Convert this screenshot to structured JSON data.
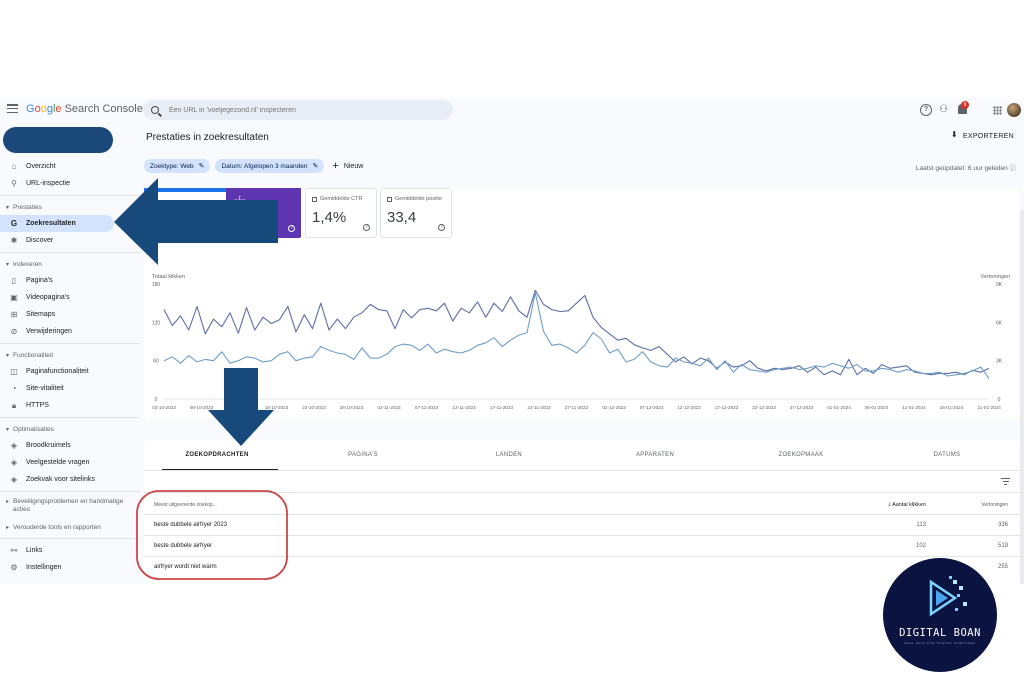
{
  "app": {
    "logo_google": [
      "G",
      "o",
      "o",
      "g",
      "l",
      "e"
    ],
    "logo_product": "Search Console",
    "search_placeholder": "Een URL in 'voeljegezond.nl' inspecteren",
    "notification_count": "9"
  },
  "sidebar": {
    "items_top": [
      {
        "label": "Overzicht",
        "icon": "home-icon"
      },
      {
        "label": "URL-inspectie",
        "icon": "search-icon"
      }
    ],
    "sections": [
      {
        "title": "Prestaties",
        "items": [
          {
            "label": "Zoekresultaten",
            "icon": "google-g-icon",
            "active": true
          },
          {
            "label": "Discover",
            "icon": "asterisk-icon"
          }
        ]
      },
      {
        "title": "Indexeren",
        "items": [
          {
            "label": "Pagina's",
            "icon": "page-icon"
          },
          {
            "label": "Videopagina's",
            "icon": "video-page-icon"
          },
          {
            "label": "Sitemaps",
            "icon": "sitemap-icon"
          },
          {
            "label": "Verwijderingen",
            "icon": "remove-icon"
          }
        ]
      },
      {
        "title": "Functionaliteit",
        "items": [
          {
            "label": "Paginafunctionaliteit",
            "icon": "page-experience-icon"
          },
          {
            "label": "Site-vitaliteit",
            "icon": "speed-icon"
          },
          {
            "label": "HTTPS",
            "icon": "lock-icon"
          }
        ]
      },
      {
        "title": "Optimalisaties",
        "items": [
          {
            "label": "Broodkruimels",
            "icon": "diamond-icon"
          },
          {
            "label": "Veelgestelde vragen",
            "icon": "diamond-icon"
          },
          {
            "label": "Zoekvak voor sitelinks",
            "icon": "diamond-icon"
          }
        ]
      }
    ],
    "collapsed": [
      "Beveiligingsproblemen en handmatige acties",
      "Verouderde tools en rapporten"
    ],
    "items_bottom": [
      {
        "label": "Links",
        "icon": "links-icon"
      },
      {
        "label": "Instellingen",
        "icon": "gear-icon"
      }
    ]
  },
  "main": {
    "title": "Prestaties in zoekresultaten",
    "export_label": "EXPORTEREN",
    "chips": [
      "Zoektype: Web",
      "Datum: Afgelopen 3 maanden"
    ],
    "new_label": "Nieuw",
    "updated": "Laatst geüpdatet: 6 uur geleden",
    "metrics": [
      {
        "label": "Gemiddelde CTR",
        "value": "1,4%"
      },
      {
        "label": "Gemiddelde positie",
        "value": "33,4"
      }
    ],
    "purple_metric_label": "...t...",
    "left_axis_title": "Totaal klikken",
    "right_axis_title": "Vertoningen"
  },
  "chart_data": {
    "type": "line",
    "x": [
      "03-10-2023",
      "08-10-2023",
      "13-10-2023",
      "18-10-2023",
      "23-10-2023",
      "28-10-2023",
      "02-11-2023",
      "07-11-2023",
      "12-11-2023",
      "17-11-2023",
      "22-11-2023",
      "27-11-2023",
      "02-12-2023",
      "07-12-2023",
      "12-12-2023",
      "17-12-2023",
      "22-12-2023",
      "27-12-2023",
      "01-01-2024",
      "06-01-2024",
      "11-01-2024",
      "16-01-2024",
      "21-01-2024"
    ],
    "y_left_ticks": [
      "0",
      "60",
      "120",
      "180"
    ],
    "y_right_ticks": [
      "0",
      "3K",
      "6K",
      "9K"
    ],
    "ylim_left": [
      0,
      180
    ],
    "ylim_right": [
      0,
      9000
    ],
    "series": [
      {
        "name": "Totaal klikken",
        "axis": "left",
        "color": "#5e6ea8",
        "values": [
          140,
          115,
          130,
          108,
          145,
          102,
          125,
          113,
          135,
          103,
          143,
          108,
          128,
          118,
          124,
          145,
          105,
          132,
          110,
          150,
          108,
          125,
          110,
          128,
          135,
          148,
          140,
          138,
          110,
          140,
          127,
          140,
          142,
          138,
          150,
          122,
          142,
          135,
          152,
          128,
          150,
          137,
          160,
          138,
          128,
          170,
          148,
          140,
          137,
          138,
          150,
          162,
          128,
          112,
          102,
          92,
          95,
          85,
          80,
          76,
          82,
          70,
          58,
          66,
          55,
          64,
          60,
          48,
          58,
          50,
          52,
          60,
          48,
          44,
          48,
          46,
          48,
          52,
          42,
          50,
          38,
          44,
          38,
          62,
          38,
          48,
          40,
          54,
          48,
          50,
          52,
          42,
          40,
          38,
          40,
          40,
          42,
          38,
          45,
          42,
          48
        ]
      },
      {
        "name": "Vertoningen",
        "axis": "right",
        "color": "#6f9fc9",
        "values": [
          3000,
          3300,
          2800,
          3400,
          2900,
          3100,
          3000,
          3700,
          2800,
          3000,
          3300,
          3200,
          2900,
          3000,
          3500,
          3700,
          3000,
          3200,
          3300,
          4100,
          3800,
          3600,
          3500,
          3100,
          4000,
          3200,
          3200,
          3500,
          4100,
          4300,
          4200,
          3800,
          4300,
          3600,
          3900,
          3700,
          3600,
          3800,
          4200,
          4400,
          4800,
          4100,
          4600,
          5000,
          5200,
          8300,
          5300,
          4200,
          4300,
          4000,
          3600,
          4200,
          5200,
          4700,
          3600,
          3900,
          2900,
          3100,
          3700,
          2900,
          2600,
          2500,
          3200,
          2900,
          2800,
          2600,
          3200,
          2300,
          3000,
          2100,
          2700,
          2300,
          2200,
          2100,
          2300,
          2400,
          2500,
          2300,
          2400,
          2600,
          2500,
          2800,
          2600,
          2400,
          2700,
          2200,
          2200,
          2400,
          2300,
          2100,
          2300,
          2200,
          2000,
          2000,
          2100,
          1800,
          1900,
          2000,
          2200,
          2500,
          1600
        ]
      }
    ]
  },
  "table": {
    "tabs": [
      "ZOEKOPDRACHTEN",
      "PAGINA'S",
      "LANDEN",
      "APPARATEN",
      "ZOEKOPMAAK",
      "DATUMS"
    ],
    "col_query": "Meest uitgevoerde zoekop...",
    "col_clicks": "Aantal klikken",
    "col_impressions": "Vertoningen",
    "rows": [
      {
        "query": "beste dubbele airfryer 2023",
        "clicks": "113",
        "impressions": "336"
      },
      {
        "query": "beste dubbele airfryer",
        "clicks": "102",
        "impressions": "519"
      },
      {
        "query": "airfryer wordt niet warm",
        "clicks": "",
        "impressions": "255"
      }
    ]
  },
  "annotations": {
    "arrow_color": "#174a7a",
    "circle_color": "#c9474b"
  },
  "brand": {
    "name": "DIGITAL BOAN",
    "tagline": "REAL DATA FOR SCHOOL PURPOSES"
  }
}
